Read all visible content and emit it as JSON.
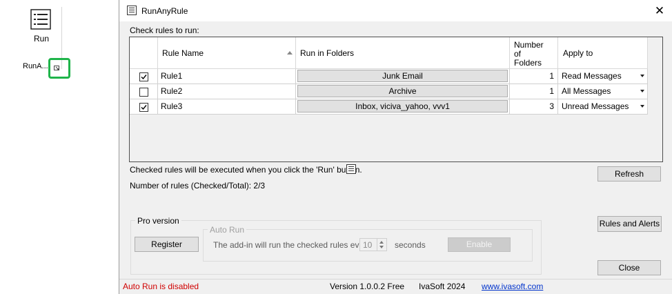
{
  "ribbon": {
    "run_label": "Run",
    "group_label": "RunA...",
    "launcher_icon": "dialog-launcher-icon"
  },
  "window": {
    "title": "RunAnyRule",
    "title_icon": "list-icon",
    "close_glyph": "✕"
  },
  "check_label": "Check rules to run:",
  "grid": {
    "columns": {
      "rule_name": "Rule Name",
      "folders": "Run in Folders",
      "num_line1": "Number",
      "num_line2": "of",
      "num_line3": "Folders",
      "apply_to": "Apply to"
    },
    "sort": "ascending",
    "rows": [
      {
        "checked": true,
        "name": "Rule1",
        "folders": "Junk Email",
        "count": "1",
        "apply": "Read Messages"
      },
      {
        "checked": false,
        "name": "Rule2",
        "folders": "Archive",
        "count": "1",
        "apply": "All Messages"
      },
      {
        "checked": true,
        "name": "Rule3",
        "folders": "Inbox, viciva_yahoo, vvv1",
        "count": "3",
        "apply": "Unread Messages"
      }
    ]
  },
  "info_text": "Checked rules will be executed when you click the 'Run' button.",
  "count_text": "Number of rules (Checked/Total): 2/3",
  "buttons": {
    "refresh": "Refresh",
    "rules_alerts": "Rules and Alerts",
    "close": "Close",
    "register": "Register",
    "enable": "Enable"
  },
  "pro": {
    "label": "Pro version",
    "auto_run_label": "Auto Run",
    "auto_desc": "The add-in will run the checked rules every",
    "interval": "10",
    "seconds": "seconds"
  },
  "status": {
    "auto_run_state": "Auto Run is disabled",
    "version": "Version 1.0.0.2 Free",
    "company": "IvaSoft 2024",
    "website": "www.ivasoft.com"
  },
  "colors": {
    "highlight": "#1fb44a",
    "status_error": "#d00000",
    "link": "#0033cc"
  }
}
